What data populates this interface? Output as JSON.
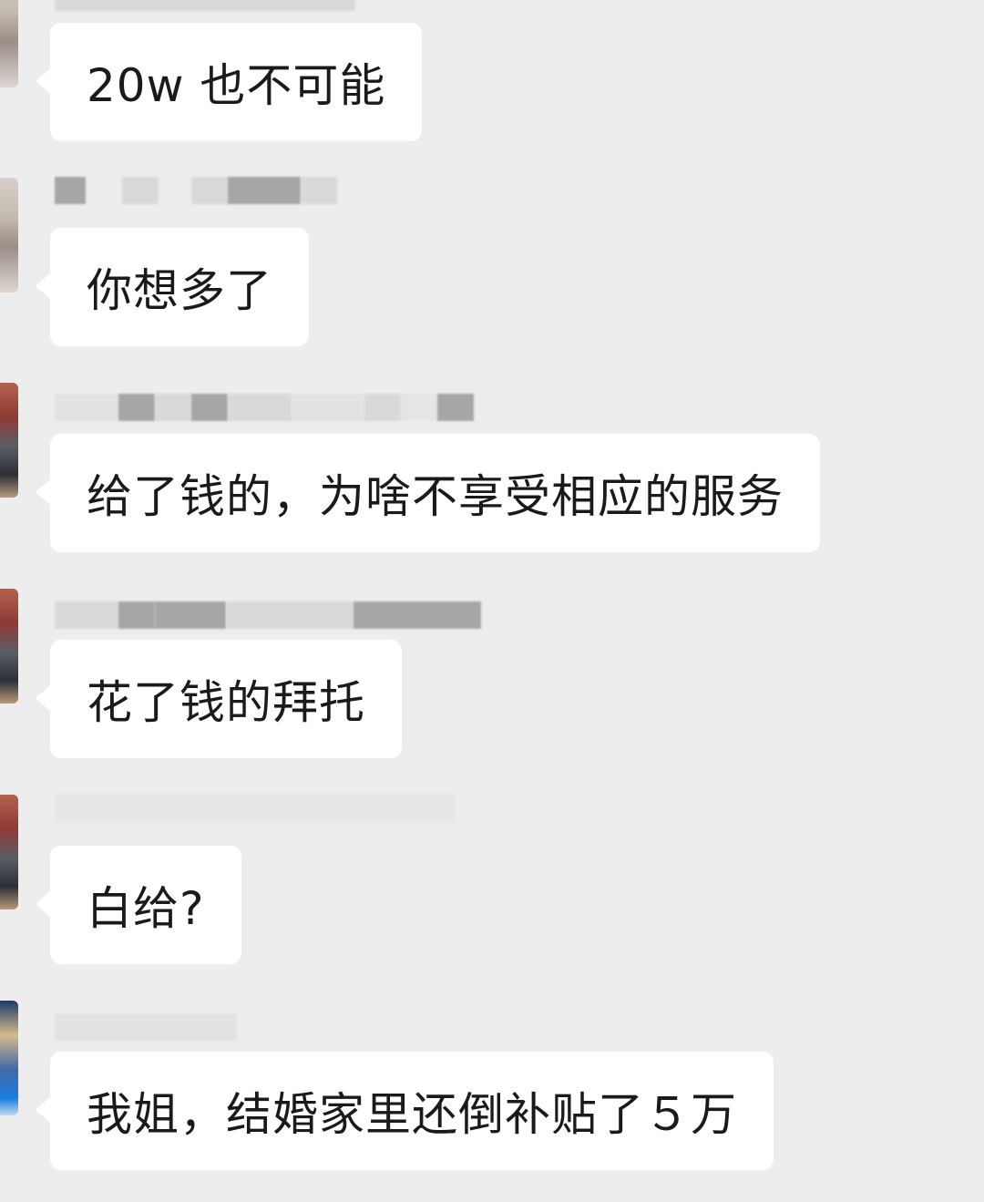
{
  "messages": [
    {
      "text": "20w 也不可能"
    },
    {
      "text": "你想多了"
    },
    {
      "text": "给了钱的，为啥不享受相应的服务"
    },
    {
      "text": "花了钱的拜托"
    },
    {
      "text": "白给?"
    },
    {
      "text": "我姐，结婚家里还倒补贴了５万"
    }
  ]
}
